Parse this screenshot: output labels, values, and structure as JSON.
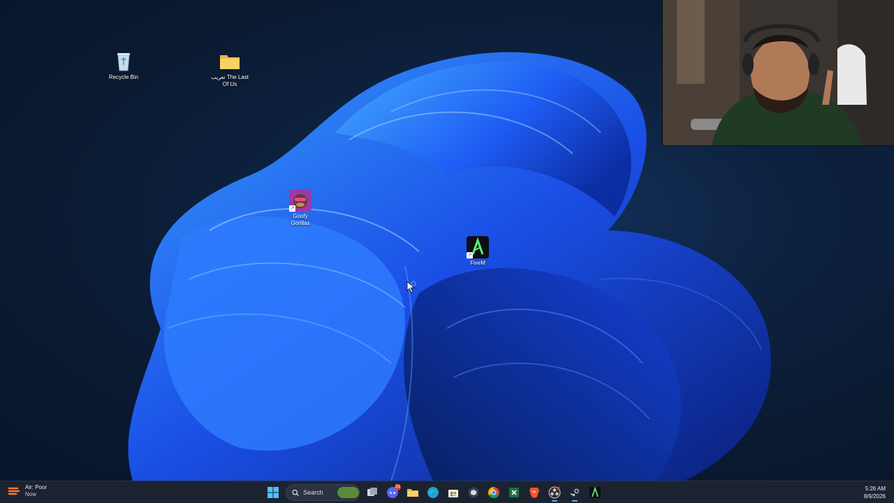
{
  "desktop": {
    "icons": [
      {
        "label": "Recycle Bin",
        "icon": "recycle-bin-icon"
      },
      {
        "label": "تعريب The Last Of Us",
        "icon": "folder-icon"
      },
      {
        "label": "Goofy Gorillas",
        "icon": "goofy-gorillas-app-icon",
        "shortcut": true
      },
      {
        "label": "FiveM",
        "icon": "fivem-app-icon",
        "shortcut": true
      }
    ]
  },
  "taskbar": {
    "weather": {
      "title": "Air: Poor",
      "subtitle": "Now",
      "icon": "air-quality-icon"
    },
    "search_placeholder": "Search",
    "pinned": [
      {
        "name": "start",
        "icon": "windows-start-icon"
      },
      {
        "name": "search",
        "icon": "search-icon"
      },
      {
        "name": "task-view",
        "icon": "task-view-icon"
      },
      {
        "name": "discord",
        "icon": "discord-icon",
        "badge": "31"
      },
      {
        "name": "file-explorer",
        "icon": "folder-icon"
      },
      {
        "name": "edge",
        "icon": "edge-icon"
      },
      {
        "name": "store",
        "icon": "store-icon"
      },
      {
        "name": "unity",
        "icon": "cube-icon"
      },
      {
        "name": "chrome",
        "icon": "chrome-icon"
      },
      {
        "name": "excel",
        "icon": "excel-icon"
      },
      {
        "name": "brave",
        "icon": "brave-icon"
      },
      {
        "name": "obs",
        "icon": "obs-icon",
        "active": true
      },
      {
        "name": "steam",
        "icon": "steam-icon",
        "active": true
      },
      {
        "name": "fivem",
        "icon": "fivem-icon"
      }
    ],
    "clock": {
      "time": "5:26 AM",
      "date": "8/9/2026"
    }
  },
  "colors": {
    "taskbar_bg": "#1c2330",
    "wallpaper_blue": "#1f5cff",
    "accent": "#60b3ff"
  }
}
